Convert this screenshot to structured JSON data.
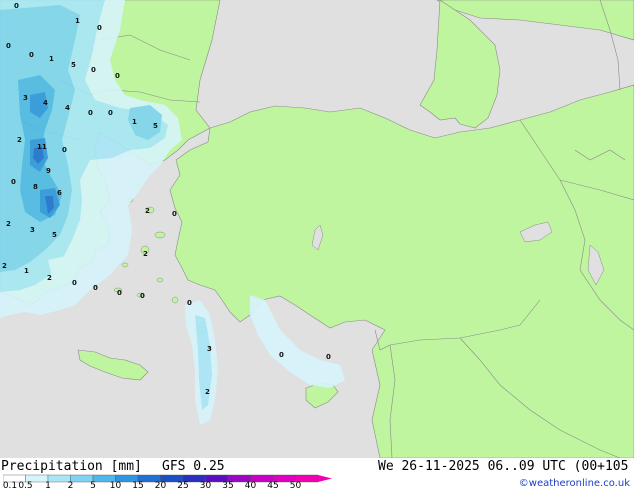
{
  "header": {
    "title": "Precipitation [mm]",
    "model": "GFS 0.25",
    "valid_time": "We 26-11-2025 06..09 UTC (00+105"
  },
  "legend": {
    "ticks": [
      "0.1",
      "0.5",
      "1",
      "2",
      "5",
      "10",
      "15",
      "20",
      "25",
      "30",
      "35",
      "40",
      "45",
      "50"
    ],
    "colors": [
      "#ffffff",
      "#d6f4fb",
      "#a8e6f7",
      "#7fd3f2",
      "#4fb8ea",
      "#2e95e0",
      "#1f6fd4",
      "#1a4fc8",
      "#2a2fc0",
      "#5a10c0",
      "#9a06c4",
      "#c800c8",
      "#e000c0",
      "#f000b0"
    ]
  },
  "credit": "©weatheronline.co.uk",
  "colors": {
    "land": "#bff59e",
    "sea": "#e0e0e0",
    "border": "#8a8a8a"
  },
  "map_values": [
    "0",
    "1",
    "0",
    "0",
    "5",
    "0",
    "1",
    "0",
    "0",
    "3",
    "4",
    "4",
    "0",
    "0",
    "1",
    "5",
    "2",
    "11",
    "0",
    "0",
    "8",
    "9",
    "6",
    "2",
    "3",
    "5",
    "2",
    "0",
    "2",
    "2",
    "1",
    "2",
    "0",
    "0",
    "0",
    "0",
    "0",
    "3",
    "0",
    "2",
    "0"
  ]
}
